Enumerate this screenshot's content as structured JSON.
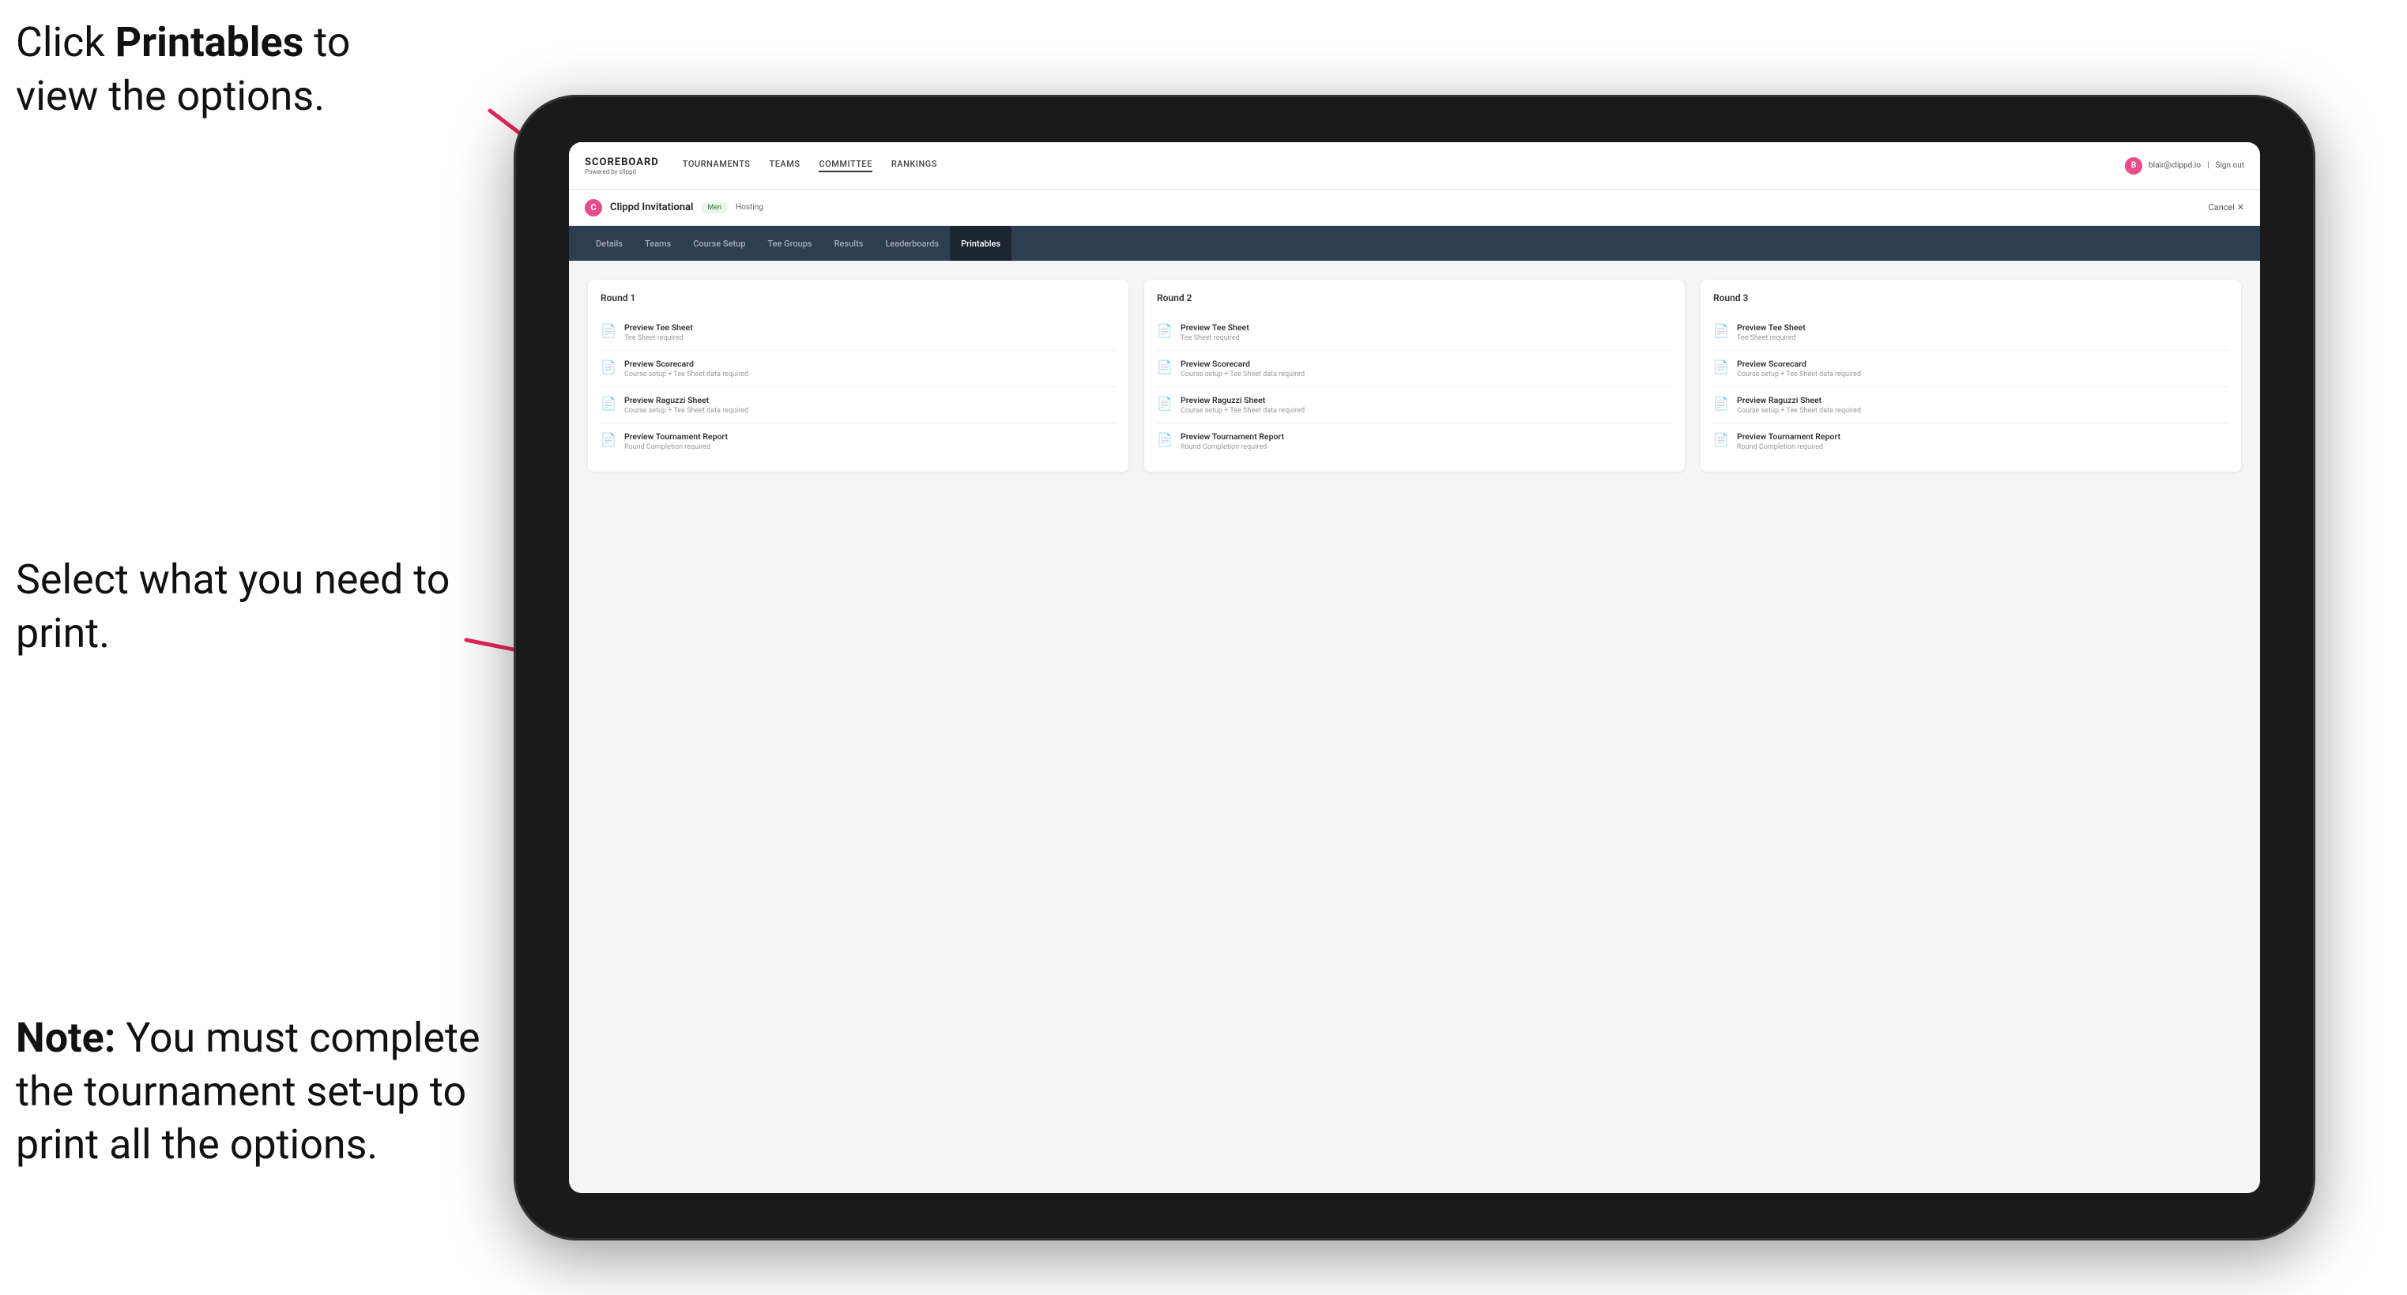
{
  "annotations": {
    "top_text_line1": "Click ",
    "top_text_bold": "Printables",
    "top_text_line2": " to",
    "top_text_line3": "view the options.",
    "middle_text": "Select what you need to print.",
    "bottom_note_bold": "Note:",
    "bottom_note_text": " You must complete the tournament set-up to print all the options."
  },
  "nav": {
    "logo": "SCOREBOARD",
    "logo_sub": "Powered by clippd",
    "links": [
      "TOURNAMENTS",
      "TEAMS",
      "COMMITTEE",
      "RANKINGS"
    ],
    "user_email": "blair@clippd.io",
    "sign_out": "Sign out",
    "user_initial": "B"
  },
  "tournament": {
    "initial": "C",
    "name": "Clippd Invitational",
    "division": "Men",
    "status": "Hosting",
    "cancel_label": "Cancel ✕"
  },
  "sub_tabs": {
    "tabs": [
      "Details",
      "Teams",
      "Course Setup",
      "Tee Groups",
      "Results",
      "Leaderboards",
      "Printables"
    ],
    "active": "Printables"
  },
  "rounds": [
    {
      "title": "Round 1",
      "items": [
        {
          "label": "Preview Tee Sheet",
          "sub": "Tee Sheet required"
        },
        {
          "label": "Preview Scorecard",
          "sub": "Course setup + Tee Sheet data required"
        },
        {
          "label": "Preview Raguzzi Sheet",
          "sub": "Course setup + Tee Sheet data required"
        },
        {
          "label": "Preview Tournament Report",
          "sub": "Round Completion required"
        }
      ]
    },
    {
      "title": "Round 2",
      "items": [
        {
          "label": "Preview Tee Sheet",
          "sub": "Tee Sheet required"
        },
        {
          "label": "Preview Scorecard",
          "sub": "Course setup + Tee Sheet data required"
        },
        {
          "label": "Preview Raguzzi Sheet",
          "sub": "Course setup + Tee Sheet data required"
        },
        {
          "label": "Preview Tournament Report",
          "sub": "Round Completion required"
        }
      ]
    },
    {
      "title": "Round 3",
      "items": [
        {
          "label": "Preview Tee Sheet",
          "sub": "Tee Sheet required"
        },
        {
          "label": "Preview Scorecard",
          "sub": "Course setup + Tee Sheet data required"
        },
        {
          "label": "Preview Raguzzi Sheet",
          "sub": "Course setup + Tee Sheet data required"
        },
        {
          "label": "Preview Tournament Report",
          "sub": "Round Completion required"
        }
      ]
    }
  ]
}
